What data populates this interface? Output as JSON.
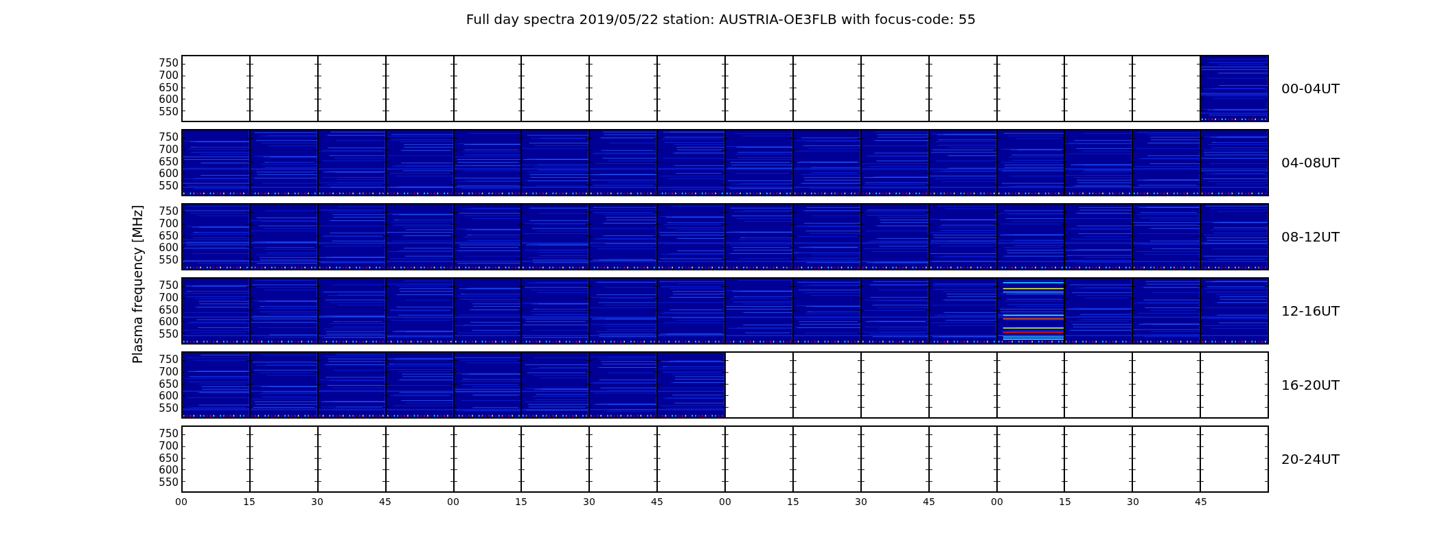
{
  "title": "Full day spectra 2019/05/22 station: AUSTRIA-OE3FLB with focus-code: 55",
  "ylabel": "Plasma frequency [MHz]",
  "xticks": [
    "00",
    "15",
    "30",
    "45",
    "00",
    "15",
    "30",
    "45",
    "00",
    "15",
    "30",
    "45",
    "00",
    "15",
    "30",
    "45"
  ],
  "rows": [
    {
      "label": "00-04UT",
      "yticks": [
        "750",
        "700",
        "650",
        "600",
        "550"
      ],
      "blocks": [
        {
          "kind": "empty"
        },
        {
          "kind": "empty"
        },
        {
          "kind": "empty"
        },
        {
          "kind": "empty"
        },
        {
          "kind": "empty"
        },
        {
          "kind": "empty"
        },
        {
          "kind": "empty"
        },
        {
          "kind": "empty"
        },
        {
          "kind": "empty"
        },
        {
          "kind": "empty"
        },
        {
          "kind": "empty"
        },
        {
          "kind": "empty"
        },
        {
          "kind": "empty"
        },
        {
          "kind": "empty"
        },
        {
          "kind": "empty"
        },
        {
          "kind": "noise"
        }
      ]
    },
    {
      "label": "04-08UT",
      "yticks": [
        "750",
        "700",
        "650",
        "600",
        "550"
      ],
      "blocks": [
        {
          "kind": "noise"
        },
        {
          "kind": "noise"
        },
        {
          "kind": "noise"
        },
        {
          "kind": "noise"
        },
        {
          "kind": "noise"
        },
        {
          "kind": "noise"
        },
        {
          "kind": "noise"
        },
        {
          "kind": "noise"
        },
        {
          "kind": "noise"
        },
        {
          "kind": "noise"
        },
        {
          "kind": "noise"
        },
        {
          "kind": "noise"
        },
        {
          "kind": "noise"
        },
        {
          "kind": "noise"
        },
        {
          "kind": "noise"
        },
        {
          "kind": "noise"
        }
      ]
    },
    {
      "label": "08-12UT",
      "yticks": [
        "750",
        "700",
        "650",
        "600",
        "550"
      ],
      "blocks": [
        {
          "kind": "noise"
        },
        {
          "kind": "noise"
        },
        {
          "kind": "noise"
        },
        {
          "kind": "noise"
        },
        {
          "kind": "noise"
        },
        {
          "kind": "noise"
        },
        {
          "kind": "noise"
        },
        {
          "kind": "noise"
        },
        {
          "kind": "noise"
        },
        {
          "kind": "noise"
        },
        {
          "kind": "noise"
        },
        {
          "kind": "noise"
        },
        {
          "kind": "noise"
        },
        {
          "kind": "noise"
        },
        {
          "kind": "noise"
        },
        {
          "kind": "noise"
        }
      ]
    },
    {
      "label": "12-16UT",
      "yticks": [
        "750",
        "700",
        "650",
        "600",
        "550"
      ],
      "blocks": [
        {
          "kind": "noise"
        },
        {
          "kind": "noise"
        },
        {
          "kind": "noise"
        },
        {
          "kind": "noise"
        },
        {
          "kind": "noise"
        },
        {
          "kind": "noise"
        },
        {
          "kind": "noise"
        },
        {
          "kind": "noise"
        },
        {
          "kind": "noise"
        },
        {
          "kind": "noise"
        },
        {
          "kind": "noise"
        },
        {
          "kind": "noise"
        },
        {
          "kind": "burst"
        },
        {
          "kind": "noise"
        },
        {
          "kind": "noise"
        },
        {
          "kind": "noise"
        }
      ]
    },
    {
      "label": "16-20UT",
      "yticks": [
        "750",
        "700",
        "650",
        "600",
        "550"
      ],
      "blocks": [
        {
          "kind": "noise"
        },
        {
          "kind": "noise"
        },
        {
          "kind": "noise"
        },
        {
          "kind": "noise"
        },
        {
          "kind": "noise"
        },
        {
          "kind": "noise"
        },
        {
          "kind": "noise"
        },
        {
          "kind": "noise"
        },
        {
          "kind": "empty"
        },
        {
          "kind": "empty"
        },
        {
          "kind": "empty"
        },
        {
          "kind": "empty"
        },
        {
          "kind": "empty"
        },
        {
          "kind": "empty"
        },
        {
          "kind": "empty"
        },
        {
          "kind": "empty"
        }
      ]
    },
    {
      "label": "20-24UT",
      "yticks": [
        "750",
        "700",
        "650",
        "600",
        "550"
      ],
      "blocks": [
        {
          "kind": "empty"
        },
        {
          "kind": "empty"
        },
        {
          "kind": "empty"
        },
        {
          "kind": "empty"
        },
        {
          "kind": "empty"
        },
        {
          "kind": "empty"
        },
        {
          "kind": "empty"
        },
        {
          "kind": "empty"
        },
        {
          "kind": "empty"
        },
        {
          "kind": "empty"
        },
        {
          "kind": "empty"
        },
        {
          "kind": "empty"
        },
        {
          "kind": "empty"
        },
        {
          "kind": "empty"
        },
        {
          "kind": "empty"
        },
        {
          "kind": "empty"
        }
      ]
    }
  ]
}
